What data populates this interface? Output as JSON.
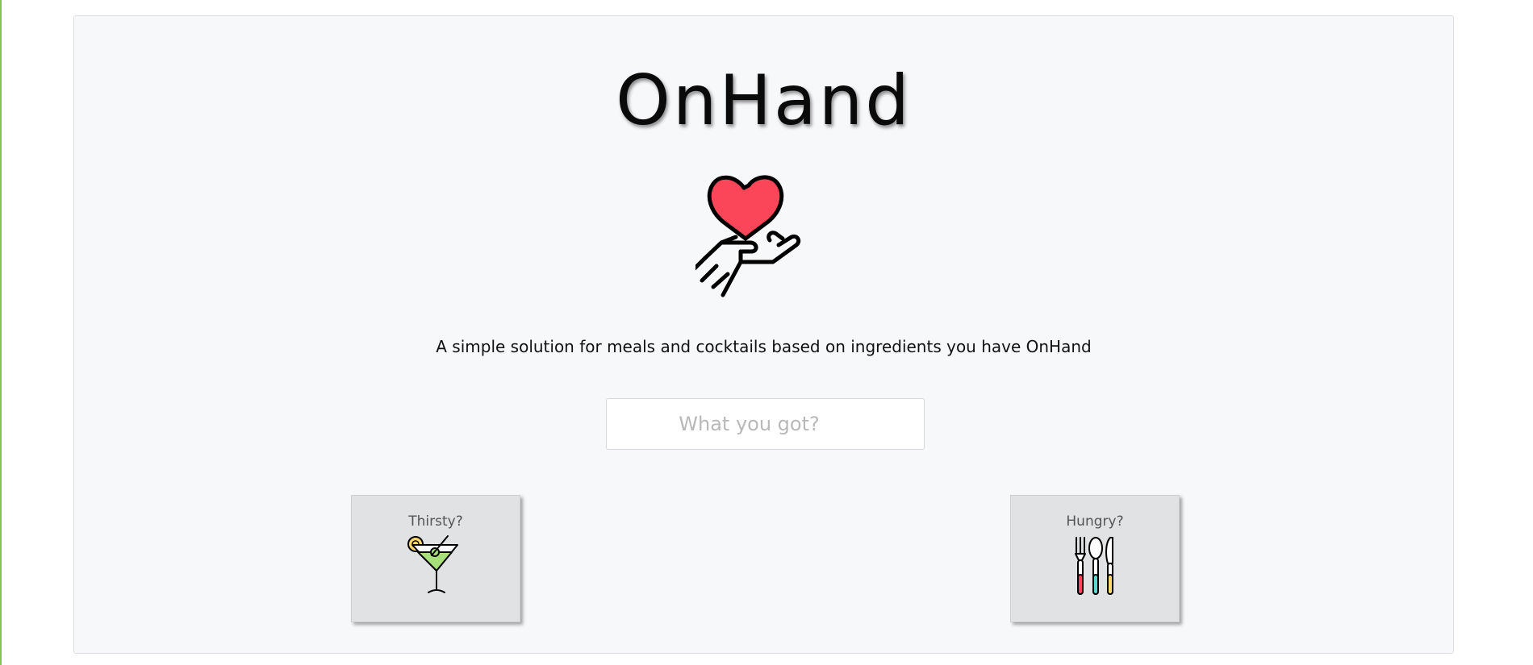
{
  "app": {
    "title": "OnHand",
    "tagline": "A simple solution for meals and cocktails based on ingredients you have OnHand"
  },
  "search": {
    "placeholder": "What you got?",
    "value": ""
  },
  "cards": {
    "thirsty": {
      "label": "Thirsty?",
      "icon": "martini-icon"
    },
    "hungry": {
      "label": "Hungry?",
      "icon": "cutlery-icon"
    }
  },
  "icons": {
    "hero": "heart-in-hand-icon"
  },
  "colors": {
    "heart": "#fb4659",
    "page_accent": "#8bc34a",
    "card_bg": "#e1e2e4",
    "panel_bg": "#f7f8fa"
  }
}
